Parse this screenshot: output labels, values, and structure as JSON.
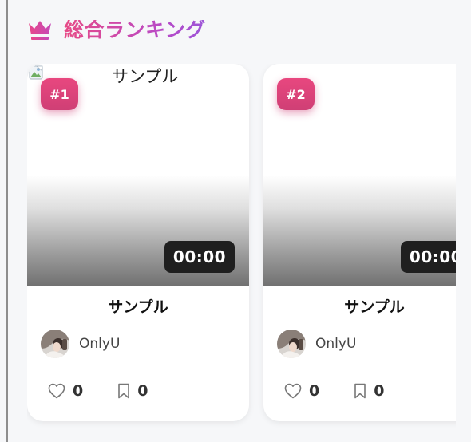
{
  "section": {
    "title": "総合ランキング",
    "icon": "crown-icon",
    "accent_color": "#d44aa0"
  },
  "cards": [
    {
      "rank": "#1",
      "image_alt": "サンプル",
      "duration": "00:00",
      "title": "サンプル",
      "creator": "OnlyU",
      "likes": "0",
      "bookmarks": "0"
    },
    {
      "rank": "#2",
      "image_alt": "",
      "duration": "00:00",
      "title": "サンプル",
      "creator": "OnlyU",
      "likes": "0",
      "bookmarks": "0"
    }
  ]
}
